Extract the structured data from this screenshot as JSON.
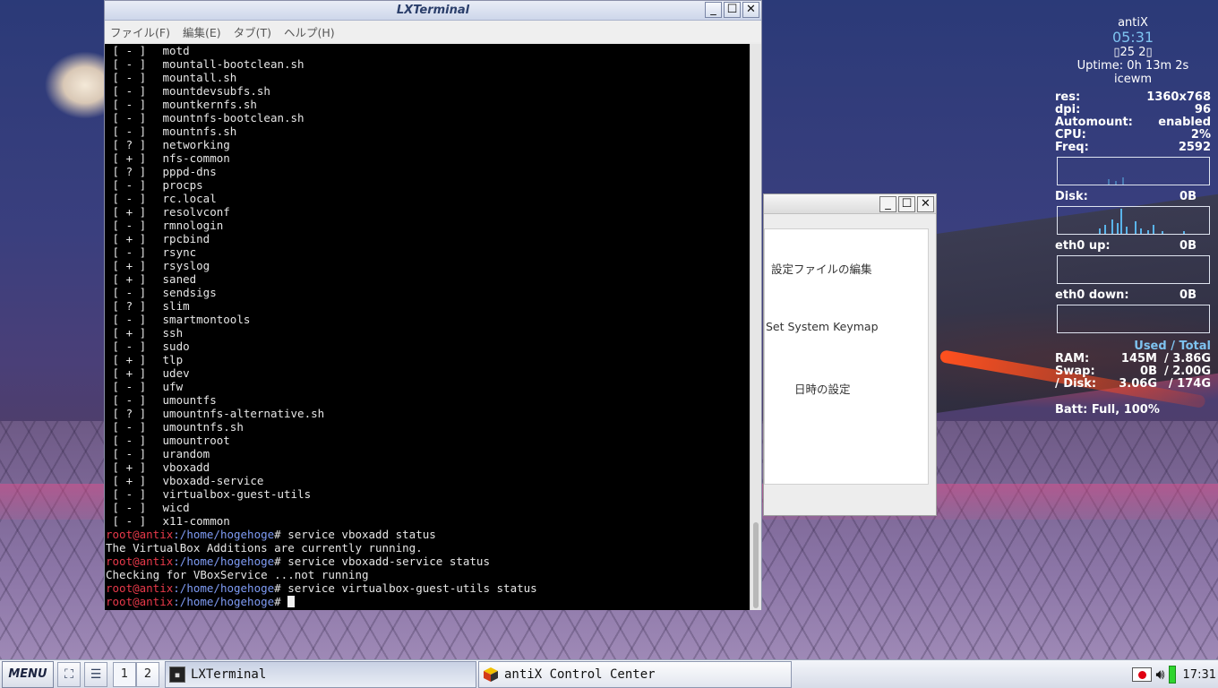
{
  "colors": {
    "prompt_user": "#e8394a",
    "prompt_path": "#7f9cf5",
    "conky_accent": "#7ec3f0",
    "graph_bar": "#5ab4ea"
  },
  "terminal": {
    "title": "LXTerminal",
    "menu": [
      "ファイル(F)",
      "編集(E)",
      "タブ(T)",
      "ヘルプ(H)"
    ],
    "services": [
      [
        "[ - ]",
        "motd"
      ],
      [
        "[ - ]",
        "mountall-bootclean.sh"
      ],
      [
        "[ - ]",
        "mountall.sh"
      ],
      [
        "[ - ]",
        "mountdevsubfs.sh"
      ],
      [
        "[ - ]",
        "mountkernfs.sh"
      ],
      [
        "[ - ]",
        "mountnfs-bootclean.sh"
      ],
      [
        "[ - ]",
        "mountnfs.sh"
      ],
      [
        "[ ? ]",
        "networking"
      ],
      [
        "[ + ]",
        "nfs-common"
      ],
      [
        "[ ? ]",
        "pppd-dns"
      ],
      [
        "[ - ]",
        "procps"
      ],
      [
        "[ - ]",
        "rc.local"
      ],
      [
        "[ + ]",
        "resolvconf"
      ],
      [
        "[ - ]",
        "rmnologin"
      ],
      [
        "[ + ]",
        "rpcbind"
      ],
      [
        "[ - ]",
        "rsync"
      ],
      [
        "[ + ]",
        "rsyslog"
      ],
      [
        "[ + ]",
        "saned"
      ],
      [
        "[ - ]",
        "sendsigs"
      ],
      [
        "[ ? ]",
        "slim"
      ],
      [
        "[ - ]",
        "smartmontools"
      ],
      [
        "[ + ]",
        "ssh"
      ],
      [
        "[ - ]",
        "sudo"
      ],
      [
        "[ + ]",
        "tlp"
      ],
      [
        "[ + ]",
        "udev"
      ],
      [
        "[ - ]",
        "ufw"
      ],
      [
        "[ - ]",
        "umountfs"
      ],
      [
        "[ ? ]",
        "umountnfs-alternative.sh"
      ],
      [
        "[ - ]",
        "umountnfs.sh"
      ],
      [
        "[ - ]",
        "umountroot"
      ],
      [
        "[ - ]",
        "urandom"
      ],
      [
        "[ + ]",
        "vboxadd"
      ],
      [
        "[ + ]",
        "vboxadd-service"
      ],
      [
        "[ - ]",
        "virtualbox-guest-utils"
      ],
      [
        "[ - ]",
        "wicd"
      ],
      [
        "[ - ]",
        "x11-common"
      ]
    ],
    "prompt_user": "root@antix",
    "prompt_path": ":/home/hogehoge",
    "prompt_sign": "# ",
    "session": [
      {
        "type": "cmd",
        "text": "service vboxadd status"
      },
      {
        "type": "out",
        "text": "The VirtualBox Additions are currently running."
      },
      {
        "type": "cmd",
        "text": "service vboxadd-service status"
      },
      {
        "type": "out",
        "text": "Checking for VBoxService ...not running"
      },
      {
        "type": "cmd",
        "text": "service virtualbox-guest-utils status"
      },
      {
        "type": "cmd",
        "text": ""
      }
    ]
  },
  "control_center": {
    "items": {
      "edit_config": "設定ファイルの編集",
      "keymap": "Set System Keymap",
      "datetime": "日時の設定"
    }
  },
  "conky": {
    "hostname": "antiX",
    "time": "05:31",
    "date": "▯25 2▯",
    "uptime": "Uptime: 0h 13m 2s",
    "wm": "icewm",
    "stats": [
      [
        "res:",
        "1360x768"
      ],
      [
        "dpi:",
        "96"
      ],
      [
        "Automount:",
        "enabled"
      ],
      [
        "CPU:",
        "2%"
      ],
      [
        "Freq:",
        "2592"
      ]
    ],
    "disk_label": "Disk:",
    "disk_val": "0B",
    "eth_up_label": "eth0 up:",
    "eth_up_val": "0B",
    "eth_down_label": "eth0 down:",
    "eth_down_val": "0B",
    "used_total": "Used / Total",
    "mem": [
      [
        "RAM:",
        "145M",
        "/ 3.86G"
      ],
      [
        "Swap:",
        "0B",
        "/ 2.00G"
      ],
      [
        "/ Disk:",
        "3.06G",
        "/ 174G"
      ]
    ],
    "batt": "Batt: Full, 100%"
  },
  "taskbar": {
    "menu_label": "MENU",
    "workspaces": [
      "1",
      "2"
    ],
    "tasks": [
      {
        "label": "LXTerminal",
        "active": true,
        "icon": "terminal-icon"
      },
      {
        "label": "antiX Control Center",
        "active": false,
        "icon": "antix-cube-icon"
      }
    ],
    "clock": "17:31"
  }
}
